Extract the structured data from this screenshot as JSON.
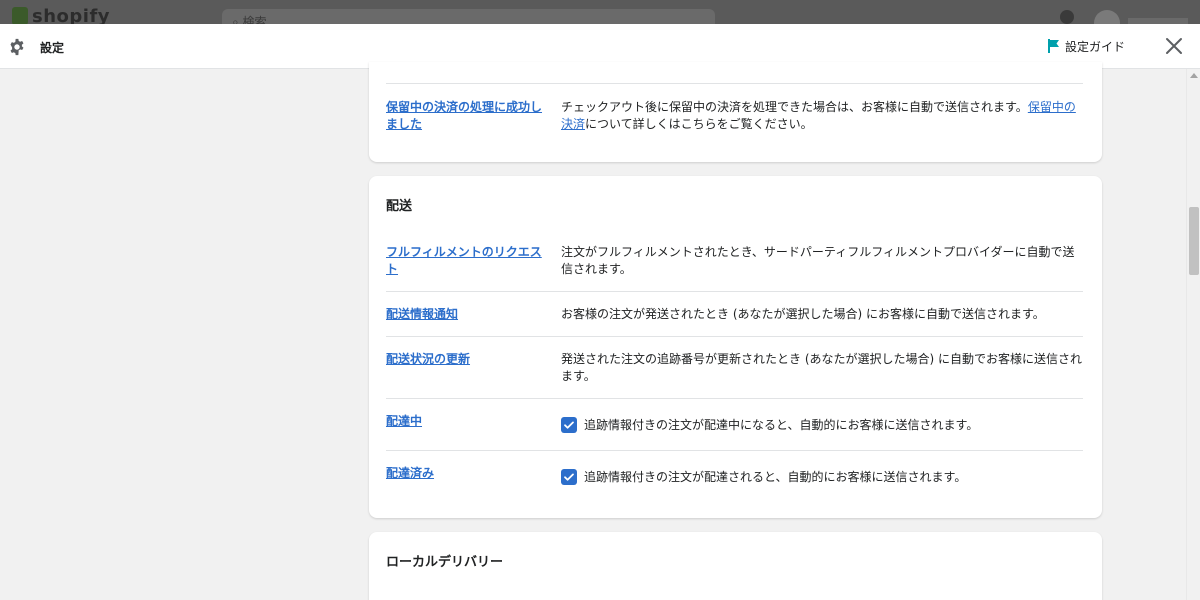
{
  "background_app": {
    "logo": "shopify",
    "search_placeholder": "検索"
  },
  "modal": {
    "title": "設定",
    "guide_label": "設定ガイド"
  },
  "colors": {
    "link": "#2c6ecb",
    "flag": "#00a0ac",
    "checkbox": "#2c6ecb"
  },
  "top_card": {
    "row": {
      "link": "保留中の決済の処理に成功しました",
      "desc": "チェックアウト後に保留中の決済を処理できた場合は、お客様に自動で送信されます。",
      "desc_link": "保留中の決済",
      "desc_suffix": "について詳しくはこちらをご覧ください。"
    }
  },
  "shipping": {
    "title": "配送",
    "rows": [
      {
        "link": "フルフィルメントのリクエスト",
        "desc": "注文がフルフィルメントされたとき、サードパーティフルフィルメントプロバイダーに自動で送信されます。"
      },
      {
        "link": "配送情報通知",
        "desc": "お客様の注文が発送されたとき (あなたが選択した場合) にお客様に自動で送信されます。"
      },
      {
        "link": "配送状況の更新",
        "desc": "発送された注文の追跡番号が更新されたとき (あなたが選択した場合) に自動でお客様に送信されます。"
      },
      {
        "link": "配達中",
        "checkbox_label": "追跡情報付きの注文が配達中になると、自動的にお客様に送信されます。",
        "checked": true
      },
      {
        "link": "配達済み",
        "checkbox_label": "追跡情報付きの注文が配達されると、自動的にお客様に送信されます。",
        "checked": true
      }
    ]
  },
  "local_delivery": {
    "title": "ローカルデリバリー"
  }
}
